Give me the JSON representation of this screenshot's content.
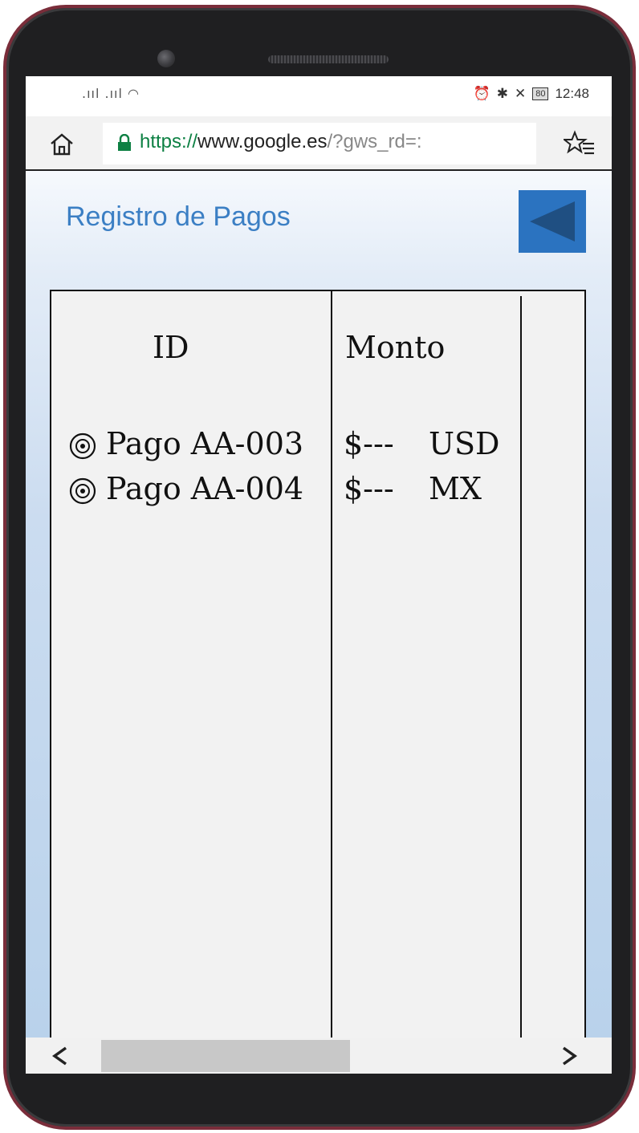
{
  "status_bar": {
    "signal_text": ".ııl .ııl",
    "time": "12:48",
    "battery": "80"
  },
  "browser": {
    "url_scheme": "https://",
    "url_host": "www.google.es",
    "url_rest": "/?gws_rd=:"
  },
  "page": {
    "title": "Registro de Pagos"
  },
  "table": {
    "columns": [
      "ID",
      "Monto"
    ],
    "rows": [
      {
        "id": "Pago AA-003",
        "amount": "$---",
        "currency": "USD"
      },
      {
        "id": "Pago AA-004",
        "amount": "$---",
        "currency": "MX"
      }
    ]
  },
  "colors": {
    "accent": "#3b7fc4",
    "back_button": "#2b73c0",
    "frame": "#7a2d3a"
  },
  "scroll": {
    "horizontal_thumb_fraction": 0.44
  }
}
